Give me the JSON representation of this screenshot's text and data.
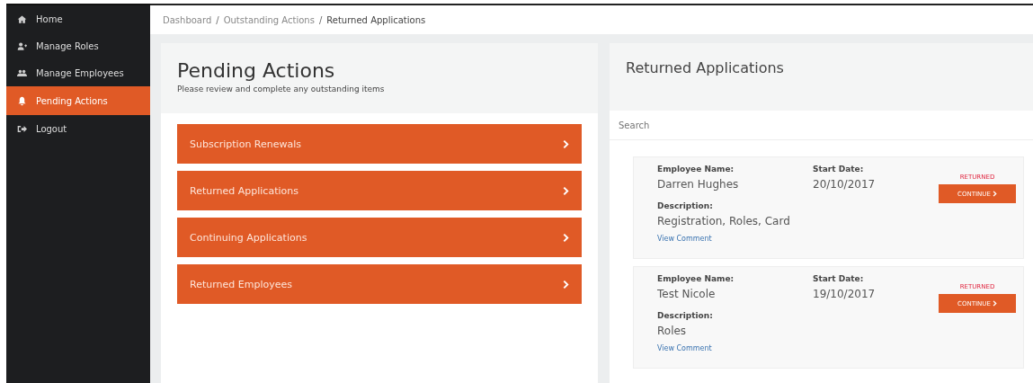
{
  "sidebar": {
    "items": [
      {
        "label": "Home",
        "selected": false
      },
      {
        "label": "Manage Roles",
        "selected": false
      },
      {
        "label": "Manage Employees",
        "selected": false
      },
      {
        "label": "Pending Actions",
        "selected": true
      },
      {
        "label": "Logout",
        "selected": false
      }
    ]
  },
  "breadcrumb": [
    {
      "label": "Dashboard",
      "current": false
    },
    {
      "separator": "/",
      "label": "Outstanding Actions",
      "current": false
    },
    {
      "separator": "/",
      "label": "Returned Applications",
      "current": true
    }
  ],
  "pending": {
    "title": "Pending Actions",
    "subtitle": "Please review and complete any outstanding items",
    "actions": [
      "Subscription Renewals",
      "Returned Applications",
      "Continuing Applications",
      "Returned Employees"
    ]
  },
  "returned": {
    "title": "Returned Applications",
    "search": {
      "placeholder": "Search"
    },
    "cards": [
      {
        "name_label": "Employee Name:",
        "name": "Darren Hughes",
        "date_label": "Start Date:",
        "date": "20/10/2017",
        "description_label": "Description:",
        "description": "Registration, Roles, Card",
        "status": "RETURNED",
        "button": "CONTINUE",
        "link": "View Comment"
      },
      {
        "name_label": "Employee Name:",
        "name": "Test Nicole",
        "date_label": "Start Date:",
        "date": "19/10/2017",
        "description_label": "Description:",
        "description": "Roles",
        "status": "RETURNED",
        "button": "CONTINUE",
        "link": "View Comment"
      }
    ]
  }
}
